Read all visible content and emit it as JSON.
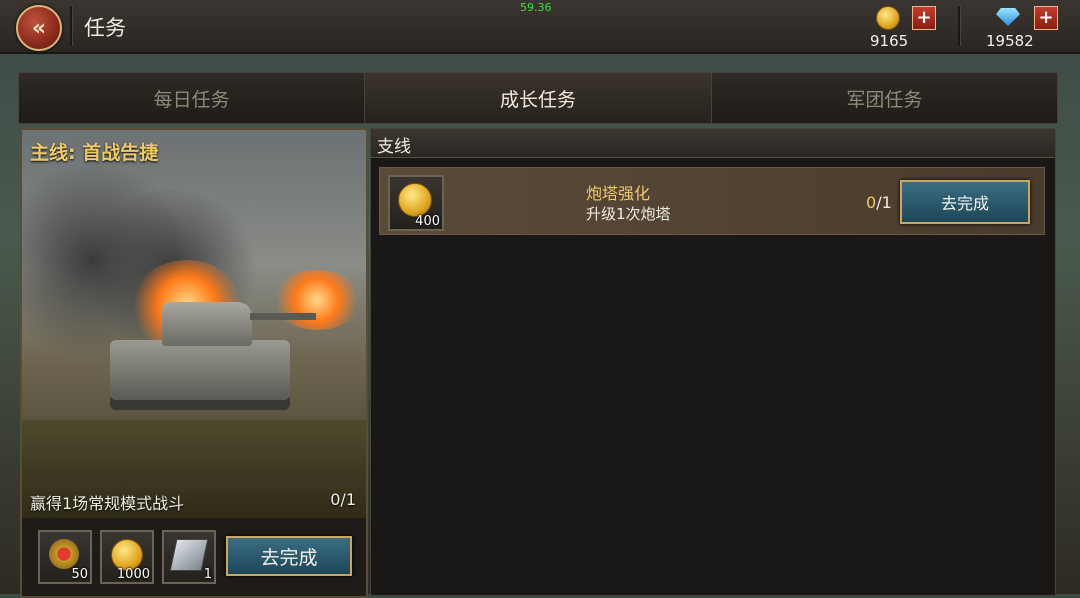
{
  "fps": "59.36",
  "header": {
    "title": "任务",
    "gold": "9165",
    "gems": "19582"
  },
  "tabs": [
    {
      "label": "每日任务",
      "active": false
    },
    {
      "label": "成长任务",
      "active": true
    },
    {
      "label": "军团任务",
      "active": false
    }
  ],
  "main_mission": {
    "title": "主线: 首战告捷",
    "description": "赢得1场常规模式战斗",
    "progress": "0/1",
    "rewards": [
      {
        "icon": "medal-icon",
        "count": "50"
      },
      {
        "icon": "gold-coin-icon",
        "count": "1000"
      },
      {
        "icon": "armor-plate-icon",
        "count": "1"
      }
    ],
    "go_label": "去完成"
  },
  "branch": {
    "header": "支线",
    "tasks": [
      {
        "icon": "gold-coin-icon",
        "reward": "400",
        "title": "炮塔强化",
        "description": "升级1次炮塔",
        "progress_current": "0",
        "progress_total": "/1",
        "go_label": "去完成"
      }
    ]
  }
}
